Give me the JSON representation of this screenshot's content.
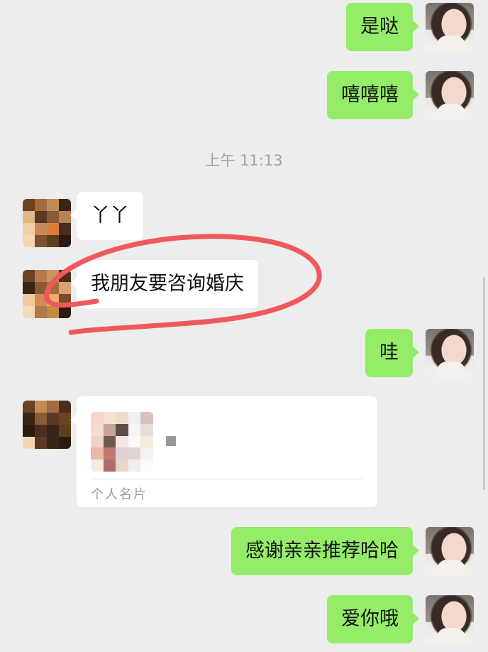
{
  "messages": [
    {
      "side": "self",
      "text": "是哒"
    },
    {
      "side": "self",
      "text": "嘻嘻嘻"
    },
    {
      "side": "other",
      "text": "丫丫"
    },
    {
      "side": "other",
      "text": "我朋友要咨询婚庆"
    },
    {
      "side": "self",
      "text": "哇"
    },
    {
      "side": "self",
      "text": "感谢亲亲推荐哈哈"
    },
    {
      "side": "self",
      "text": "爱你哦"
    }
  ],
  "timestamp": "上午 11:13",
  "contact_card": {
    "label": "个人名片"
  },
  "annotation": {
    "type": "hand-drawn red circle around message",
    "color": "#f0595c"
  },
  "colors": {
    "background": "#ededed",
    "self_bubble": "#95ec69",
    "other_bubble": "#ffffff",
    "timestamp": "#a3a3a3"
  }
}
